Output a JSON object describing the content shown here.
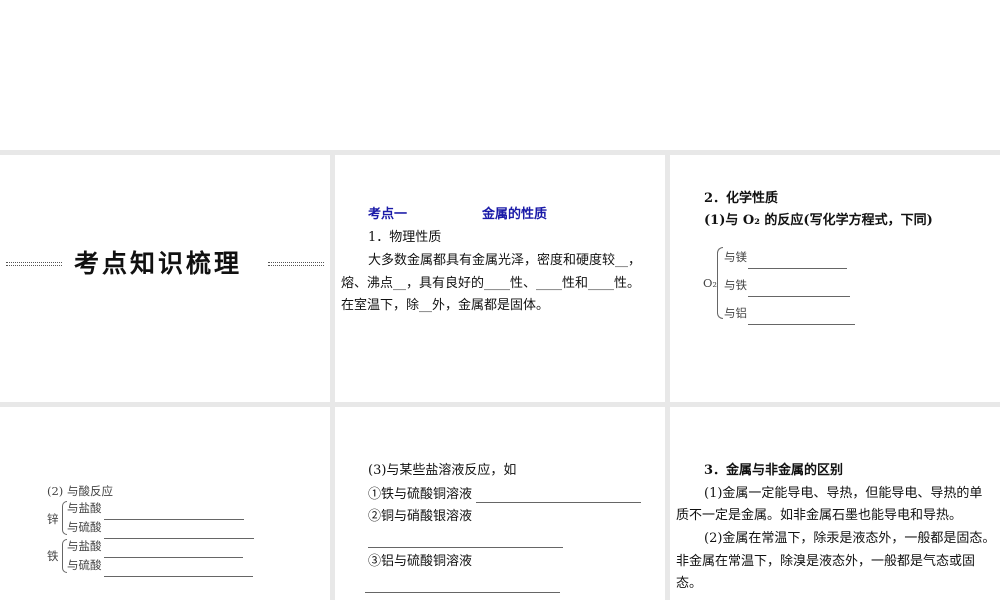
{
  "section_title": "考点知识梳理",
  "p2": {
    "topic": "考点一",
    "topic_title": "金属的性质",
    "h1": "1．物理性质",
    "lines": [
      "大多数金属都具有金属光泽，密度和硬度较__，",
      "熔、沸点__，具有良好的____性、____性和____性。",
      "在室温下，除__外，金属都是固体。"
    ]
  },
  "p3": {
    "h2": "2．化学性质",
    "sub1": "(1)与 O₂ 的反应(写化学方程式，下同)",
    "o2": "O₂",
    "items": [
      "与镁",
      "与铁",
      "与铝"
    ]
  },
  "p4": {
    "sub2": "(2) 与酸反应",
    "zinc": "锌",
    "iron": "铁",
    "acids": [
      "与盐酸",
      "与硫酸",
      "与盐酸",
      "与硫酸"
    ]
  },
  "p5": {
    "sub3": "(3)与某些盐溶液反应，如",
    "items": [
      "①铁与硫酸铜溶液",
      "②铜与硝酸银溶液",
      "③铝与硫酸铜溶液"
    ]
  },
  "p6": {
    "h3": "3．金属与非金属的区别",
    "lines": [
      "(1)金属一定能导电、导热，但能导电、导热的单",
      "质不一定是金属。如非金属石墨也能导电和导热。",
      "(2)金属在常温下，除汞是液态外，一般都是固态。",
      "非金属在常温下，除溴是液态外，一般都是气态或固",
      "态。"
    ]
  }
}
